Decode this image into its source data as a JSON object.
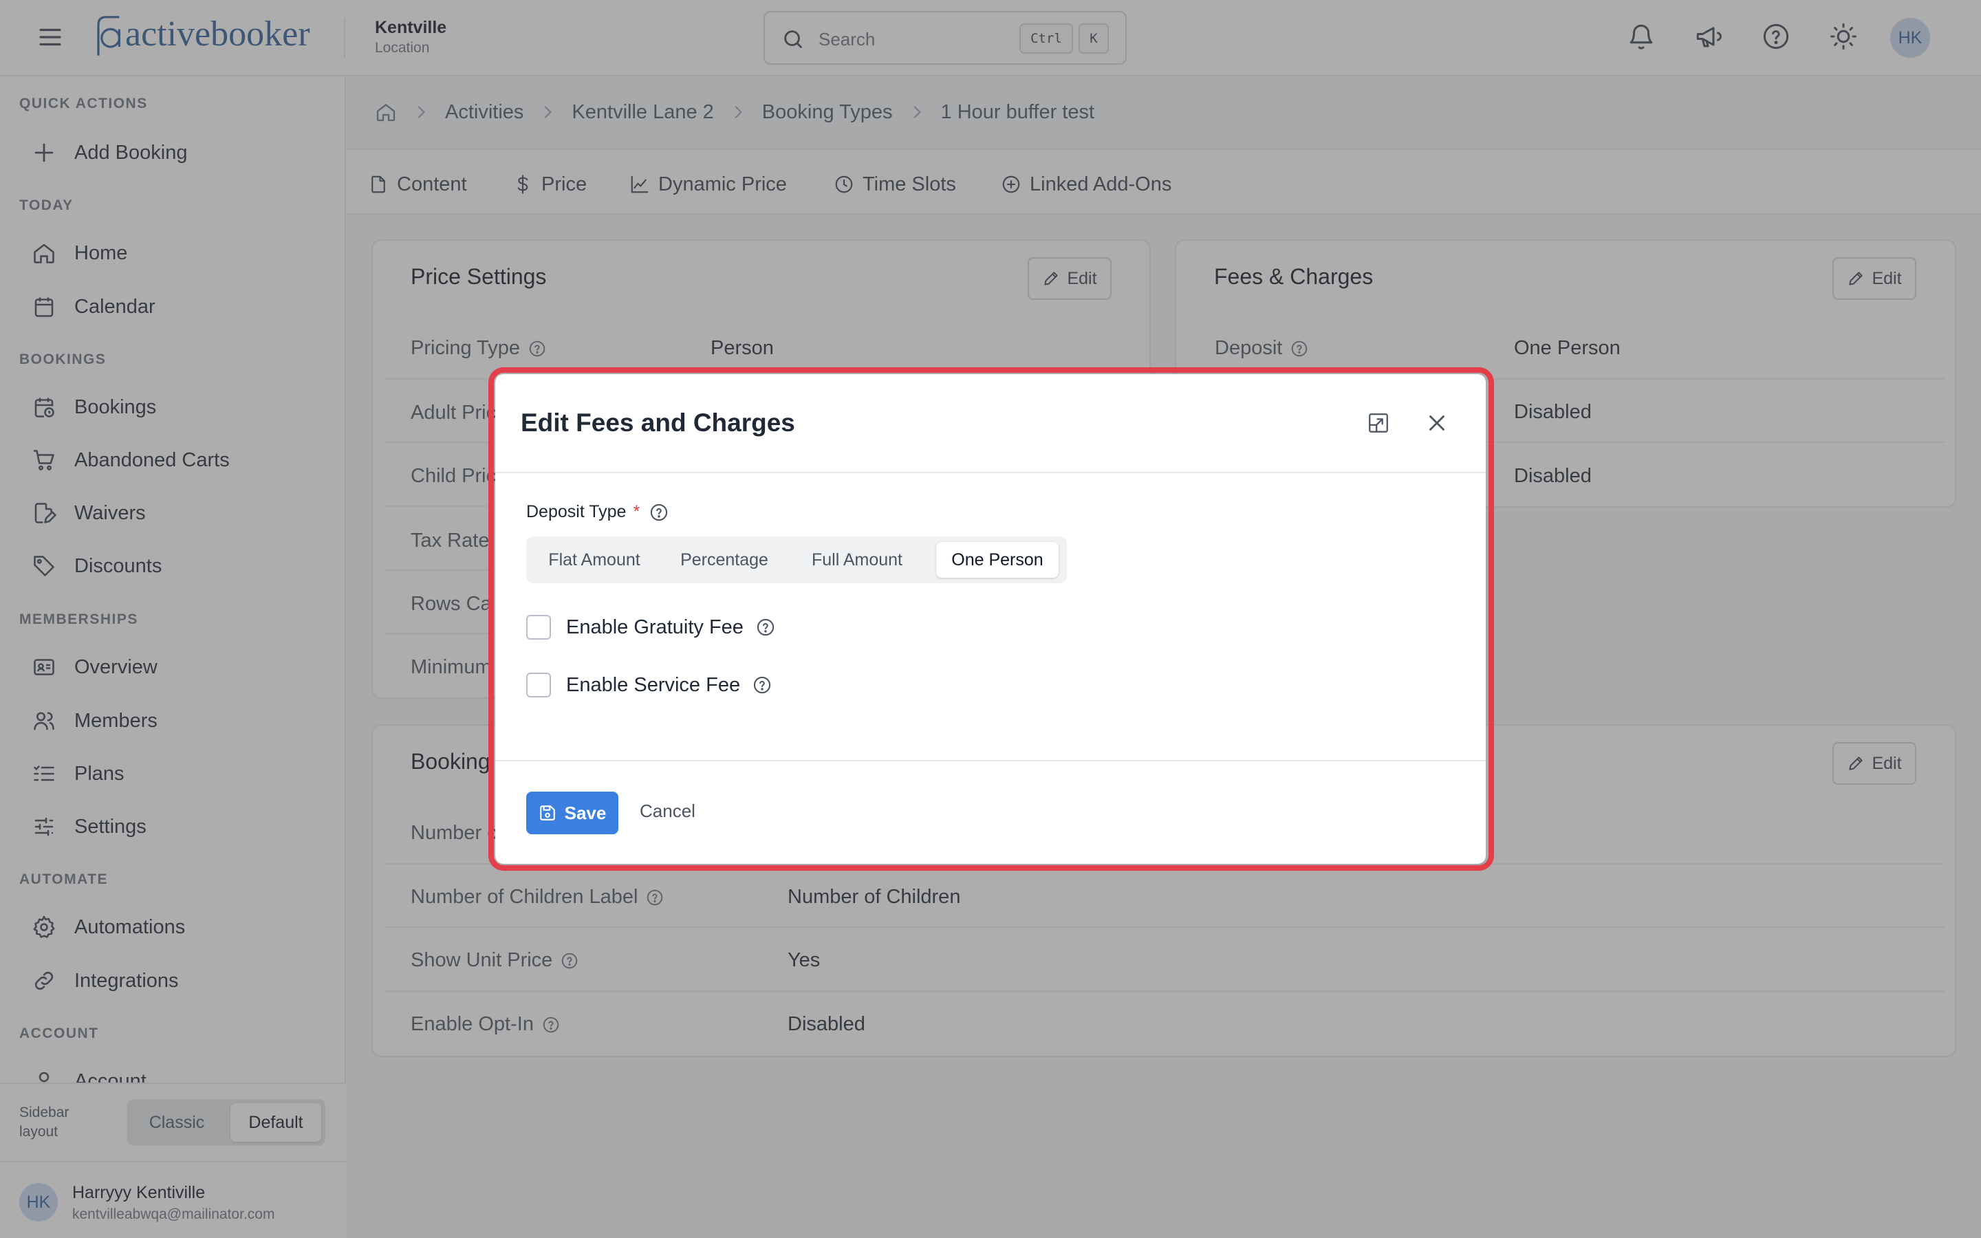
{
  "header": {
    "logo_text": "activebooker",
    "location_name": "Kentville",
    "location_sub": "Location",
    "search_placeholder": "Search",
    "shortcut_ctrl": "Ctrl",
    "shortcut_key": "K",
    "avatar_initials": "HK"
  },
  "sidebar": {
    "sections": {
      "quick_actions": "QUICK ACTIONS",
      "today": "TODAY",
      "bookings": "BOOKINGS",
      "memberships": "MEMBERSHIPS",
      "automate": "AUTOMATE",
      "account": "ACCOUNT"
    },
    "items": {
      "add_booking": "Add Booking",
      "home": "Home",
      "calendar": "Calendar",
      "bookings": "Bookings",
      "abandoned_carts": "Abandoned Carts",
      "waivers": "Waivers",
      "discounts": "Discounts",
      "overview": "Overview",
      "members": "Members",
      "plans": "Plans",
      "settings": "Settings",
      "automations": "Automations",
      "integrations": "Integrations",
      "account": "Account"
    },
    "layout": {
      "label": "Sidebar layout",
      "options": [
        "Classic",
        "Default"
      ],
      "selected": "Default"
    },
    "user": {
      "initials": "HK",
      "name": "Harryyy Kentiville",
      "email": "kentvilleabwqa@mailinator.com"
    }
  },
  "breadcrumb": [
    "Activities",
    "Kentville Lane 2",
    "Booking Types",
    "1 Hour buffer test"
  ],
  "tabs": [
    "Content",
    "Price",
    "Dynamic Price",
    "Time Slots",
    "Linked Add-Ons"
  ],
  "price_settings": {
    "title": "Price Settings",
    "edit_label": "Edit",
    "rows": [
      {
        "label": "Pricing Type",
        "value": "Person"
      },
      {
        "label": "Adult Pric",
        "value": ""
      },
      {
        "label": "Child Pric",
        "value": ""
      },
      {
        "label": "Tax Rate",
        "value": ""
      },
      {
        "label": "Rows Ca",
        "value": ""
      },
      {
        "label": "Minimum",
        "value": ""
      }
    ]
  },
  "fees_charges": {
    "title": "Fees & Charges",
    "edit_label": "Edit",
    "rows": [
      {
        "label": "Deposit",
        "value": "One Person"
      },
      {
        "label": "",
        "value": "Disabled"
      },
      {
        "label": "",
        "value": "Disabled"
      }
    ]
  },
  "booking_card": {
    "title": "Booking",
    "edit_label": "Edit",
    "rows": [
      {
        "label": "Number c",
        "value": ""
      },
      {
        "label": "Number of Children Label",
        "value": "Number of Children"
      },
      {
        "label": "Show Unit Price",
        "value": "Yes"
      },
      {
        "label": "Enable Opt-In",
        "value": "Disabled"
      }
    ]
  },
  "modal": {
    "title": "Edit Fees and Charges",
    "deposit_label": "Deposit Type",
    "required_mark": "*",
    "deposit_options": [
      "Flat Amount",
      "Percentage",
      "Full Amount",
      "One Person"
    ],
    "deposit_selected": "One Person",
    "gratuity_label": "Enable Gratuity Fee",
    "gratuity_checked": false,
    "service_label": "Enable Service Fee",
    "service_checked": false,
    "save_label": "Save",
    "cancel_label": "Cancel",
    "highlight_color": "#e53e4b",
    "primary_color": "#3b7fe0"
  }
}
